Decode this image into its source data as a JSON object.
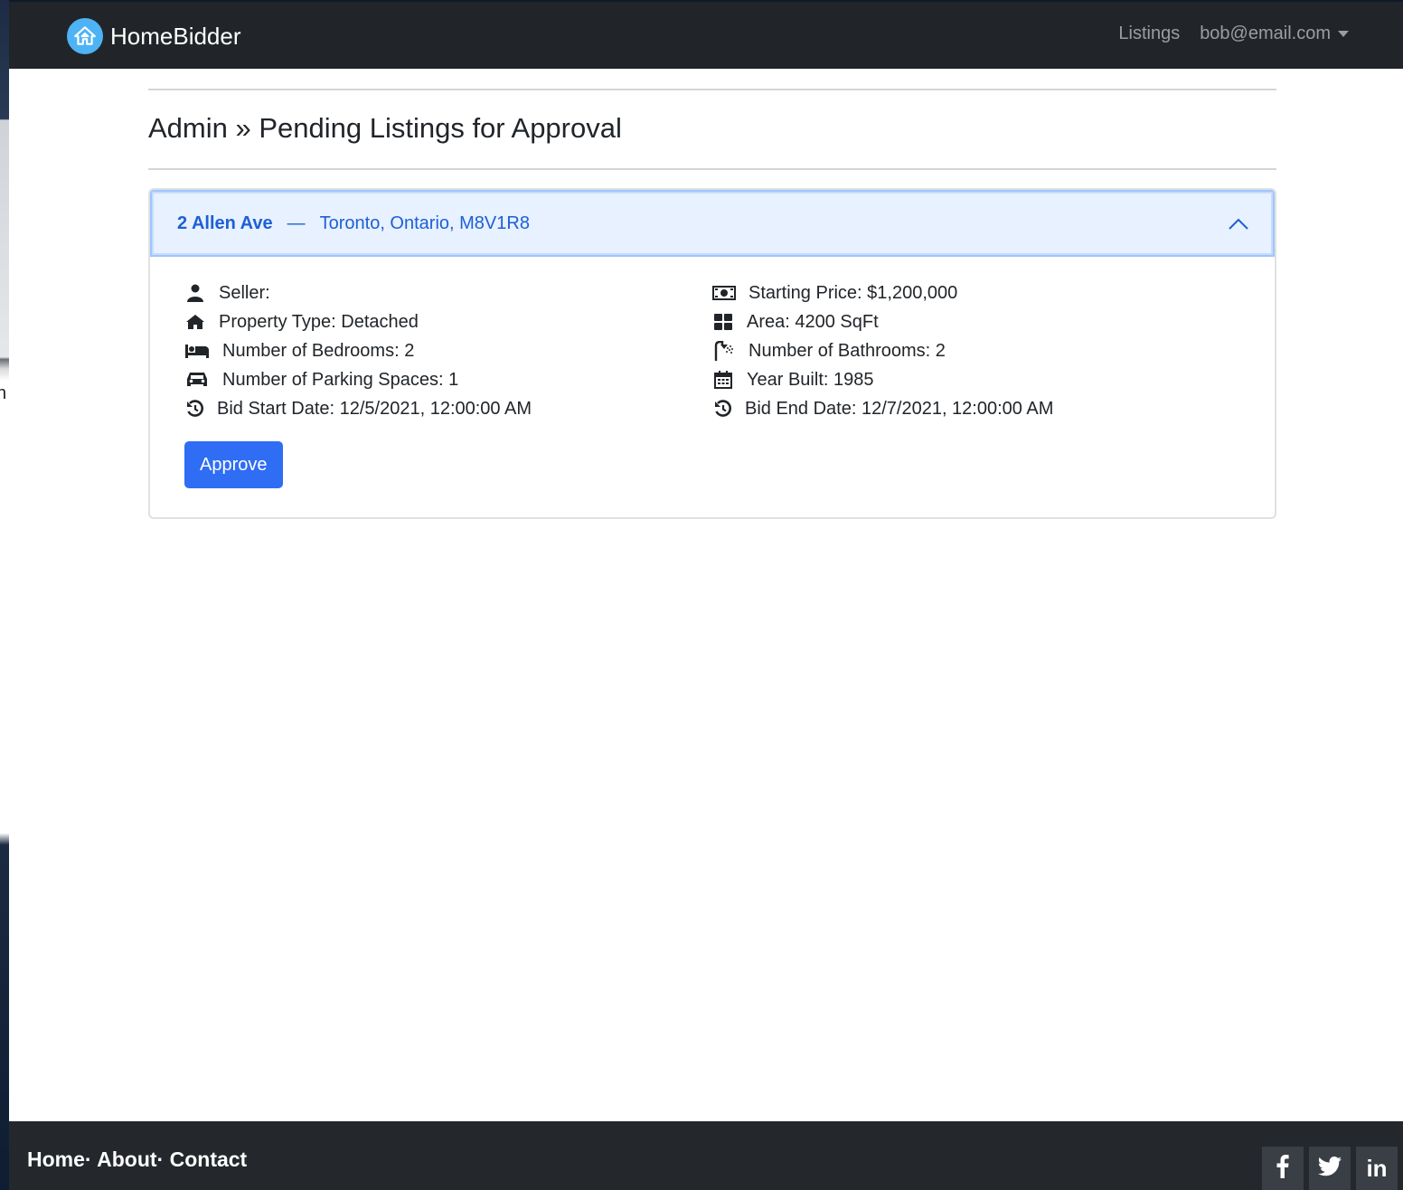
{
  "behind_window": {
    "fragment": "n"
  },
  "navbar": {
    "brand": "HomeBidder",
    "links": {
      "listings": "Listings"
    },
    "user": "bob@email.com"
  },
  "page": {
    "title": "Admin » Pending Listings for Approval"
  },
  "listing": {
    "street": "2 Allen Ave",
    "dash": "—",
    "city_line": "Toronto, Ontario, M8V1R8",
    "left": [
      {
        "icon": "user-icon",
        "text": "Seller:"
      },
      {
        "icon": "home-icon",
        "text": "Property Type: Detached"
      },
      {
        "icon": "bed-icon",
        "text": "Number of Bedrooms: 2"
      },
      {
        "icon": "car-icon",
        "text": "Number of Parking Spaces: 1"
      },
      {
        "icon": "history-icon",
        "text": "Bid Start Date: 12/5/2021, 12:00:00 AM"
      }
    ],
    "right": [
      {
        "icon": "money-bill-icon",
        "text": "Starting Price: $1,200,000"
      },
      {
        "icon": "grid-icon",
        "text": "Area: 4200 SqFt"
      },
      {
        "icon": "shower-icon",
        "text": "Number of Bathrooms: 2"
      },
      {
        "icon": "calendar-icon",
        "text": "Year Built: 1985"
      },
      {
        "icon": "history-icon",
        "text": "Bid End Date: 12/7/2021, 12:00:00 AM"
      }
    ],
    "approve_label": "Approve"
  },
  "footer": {
    "links": [
      "Home",
      "About",
      "Contact"
    ],
    "separator": "·",
    "social": {
      "facebook": "f",
      "linkedin": "in"
    }
  },
  "colors": {
    "navbar_bg": "#212529",
    "accent": "#2f6df5",
    "accordion_header_bg": "#e7f1ff",
    "accordion_text": "#1d5fd6",
    "footer_bg": "#24282d"
  }
}
